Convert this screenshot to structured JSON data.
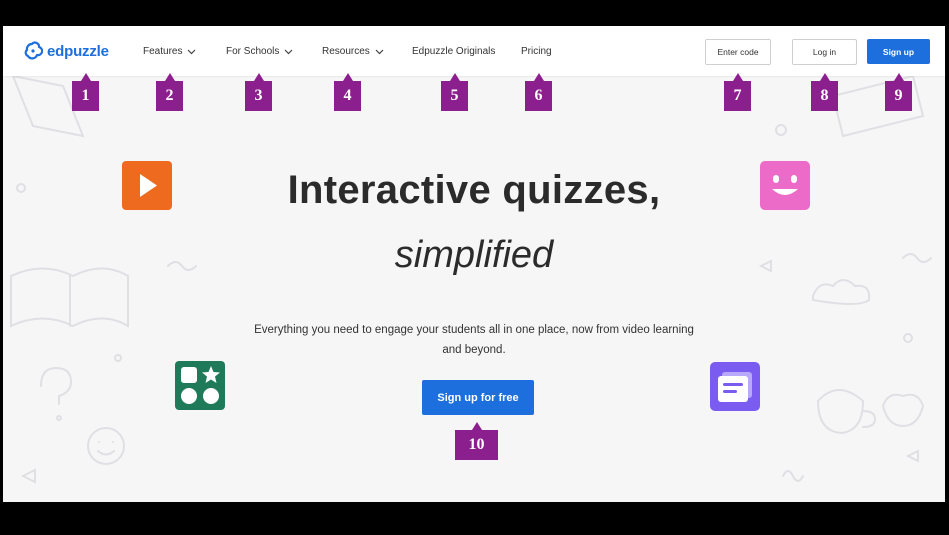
{
  "header": {
    "logo_text": "edpuzzle",
    "nav": {
      "features": "Features",
      "for_schools": "For Schools",
      "resources": "Resources",
      "originals": "Edpuzzle Originals",
      "pricing": "Pricing"
    },
    "enter_code": "Enter code",
    "log_in": "Log in",
    "sign_up": "Sign up"
  },
  "hero": {
    "title": "Interactive quizzes,",
    "subtitle": "simplified",
    "description": "Everything you need to engage your students all in one place, now from video learning and beyond.",
    "cta": "Sign up for free"
  },
  "annotations": [
    "1",
    "2",
    "3",
    "4",
    "5",
    "6",
    "7",
    "8",
    "9",
    "10"
  ],
  "colors": {
    "brand_blue": "#1d6fdd",
    "marker_purple": "#8c1f8e",
    "tile_orange": "#ee6a1f",
    "tile_pink": "#ec6ac8",
    "tile_green": "#1f7a5a",
    "tile_violet": "#7a5cf0"
  },
  "icons": [
    "edpuzzle-logo-icon",
    "play-icon",
    "smiley-icon",
    "shapes-grid-icon",
    "message-icon",
    "chevron-down-icon"
  ]
}
